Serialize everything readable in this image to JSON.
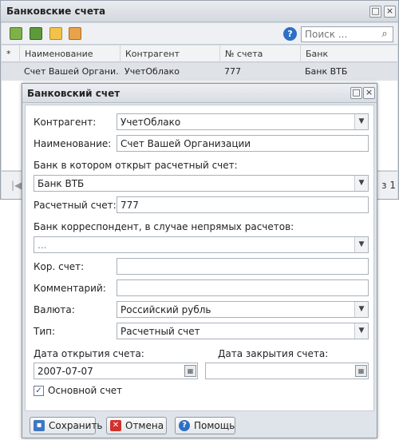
{
  "outer": {
    "title": "Банковские счета",
    "search_placeholder": "Поиск ...",
    "columns": [
      "*",
      "Наименование",
      "Контрагент",
      "№ счета",
      "Банк"
    ],
    "row": [
      "",
      "Счет Вашей Органи...",
      "УчетОблако",
      "777",
      "Банк ВТБ"
    ],
    "pager_right": "з 1"
  },
  "dialog": {
    "title": "Банковский счет",
    "labels": {
      "counterparty": "Контрагент:",
      "name": "Наименование:",
      "bank": "Банк в котором открыт расчетный счет:",
      "account": "Расчетный счет:",
      "corr_bank": "Банк корреспондент, в случае непрямых расчетов:",
      "corr_account": "Кор. счет:",
      "comment": "Комментарий:",
      "currency": "Валюта:",
      "type": "Тип:",
      "open_date": "Дата открытия счета:",
      "close_date": "Дата закрытия счета:",
      "main_account": "Основной счет"
    },
    "values": {
      "counterparty": "УчетОблако",
      "name": "Счет Вашей Организации",
      "bank": "Банк ВТБ",
      "account": "777",
      "corr_bank": "...",
      "corr_account": "",
      "comment": "",
      "currency": "Российский рубль",
      "type": "Расчетный счет",
      "open_date": "2007-07-07",
      "close_date": "",
      "main_account_checked": true
    },
    "buttons": {
      "save": "Сохранить",
      "cancel": "Отмена",
      "help": "Помощь"
    }
  },
  "colors": {
    "accent": "#2d6fc6",
    "cancel_icon": "#d2322d",
    "save_icon": "#3d76c4"
  }
}
